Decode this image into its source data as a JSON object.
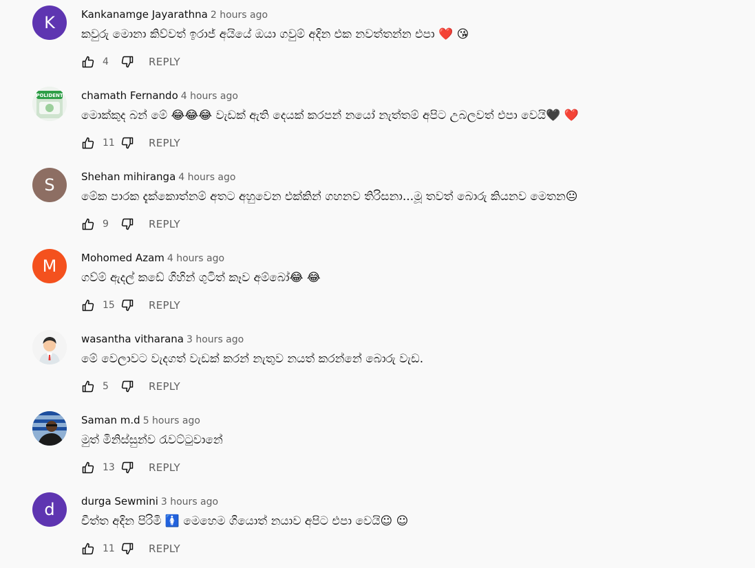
{
  "comments": [
    {
      "author": "Kankanamge Jayarathna",
      "time": "2 hours ago",
      "text": "කවුරු මොනා කිව්වත් ඉරාජ් අයියේ ඔයා ගවුම් අදින එක නවත්තන්න එපා ❤️ 😘",
      "likes": "4",
      "reply_label": "REPLY",
      "avatar": {
        "type": "letter",
        "letter": "K",
        "color": "#5e35b1"
      }
    },
    {
      "author": "chamath Fernando",
      "time": "4 hours ago",
      "text": "මොක්කුද බන් මේ 😂😂😂 වැඩක් ඇති දෙයක් කරපන් නයෝ නැත්තම් අපිට උබලවත් එපා වෙයි🖤 ❤️",
      "likes": "11",
      "reply_label": "REPLY",
      "avatar": {
        "type": "image",
        "label": "POLIDENT"
      }
    },
    {
      "author": "Shehan mihiranga",
      "time": "4 hours ago",
      "text": "මේක පාරක දැක්කොත්නම් අතට අහුවෙන එක්කින් ගහනව තිරිසනා...මූ තවත් බොරු කියනව මෙතන😐",
      "likes": "9",
      "reply_label": "REPLY",
      "avatar": {
        "type": "letter",
        "letter": "S",
        "color": "#8d6e63"
      }
    },
    {
      "author": "Mohomed Azam",
      "time": "4 hours ago",
      "text": "ගව්ම් ඇදල් කඩේ ගිහින් ගුටිත් කෑව අම්බෝ😂 😂",
      "likes": "15",
      "reply_label": "REPLY",
      "avatar": {
        "type": "letter",
        "letter": "M",
        "color": "#f4511e"
      }
    },
    {
      "author": "wasantha vitharana",
      "time": "3 hours ago",
      "text": "මේ වෙලාවට වැදගත් වැඩක් කරන් නැතුව නයත් කරන්නේ බොරු වැඩ.",
      "likes": "5",
      "reply_label": "REPLY",
      "avatar": {
        "type": "image",
        "label": ""
      }
    },
    {
      "author": "Saman m.d",
      "time": "5 hours ago",
      "text": "මුත් මිනිස්සුන්ව රැවට්ටුවානේ",
      "likes": "13",
      "reply_label": "REPLY",
      "avatar": {
        "type": "image",
        "label": ""
      }
    },
    {
      "author": "durga Sewmini",
      "time": "3 hours ago",
      "text": "චීත්ත අදින පිරිමි 🚺 මෙහෙම ගියොත් නයාව අපිට එපා වෙයි☺ ☺",
      "likes": "11",
      "reply_label": "REPLY",
      "avatar": {
        "type": "letter",
        "letter": "d",
        "color": "#5e35b1"
      }
    }
  ],
  "icons": {
    "like": "thumbs-up-icon",
    "dislike": "thumbs-down-icon"
  }
}
